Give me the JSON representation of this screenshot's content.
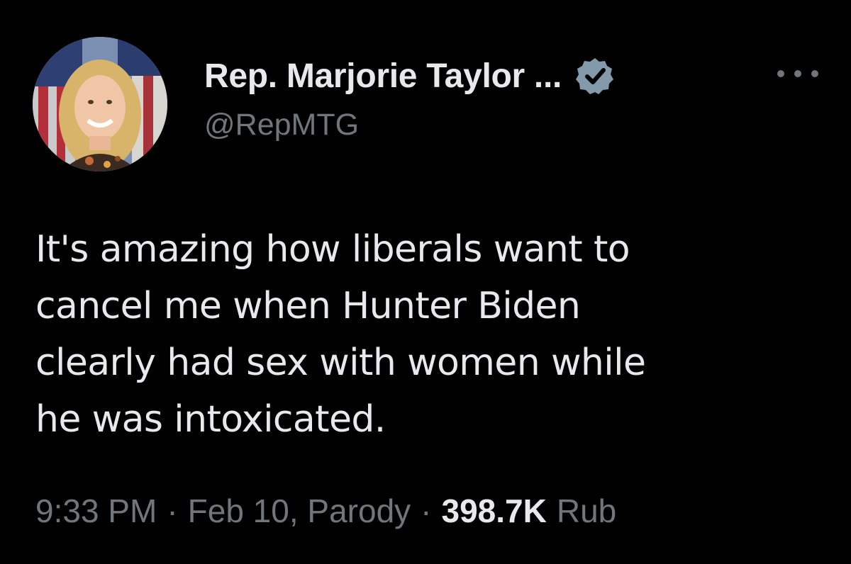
{
  "tweet": {
    "author": {
      "display_name": "Rep. Marjorie Taylor ...",
      "handle": "@RepMTG",
      "verified_icon": "verified-badge-icon",
      "avatar_icon": "profile-photo"
    },
    "more_icon": "more-options-icon",
    "text_lines": [
      "It's amazing how liberals want to",
      "cancel me when Hunter Biden",
      "clearly had sex with women while",
      "he was intoxicated."
    ],
    "meta": {
      "time": "9:33 PM",
      "separator": "·",
      "date": "Feb 10, Parody",
      "count": "398.7K",
      "count_label": "Rub"
    }
  },
  "colors": {
    "background": "#000000",
    "primary_text": "#e7e9ea",
    "secondary_text": "#71767b",
    "verified_badge": "#829aab"
  }
}
